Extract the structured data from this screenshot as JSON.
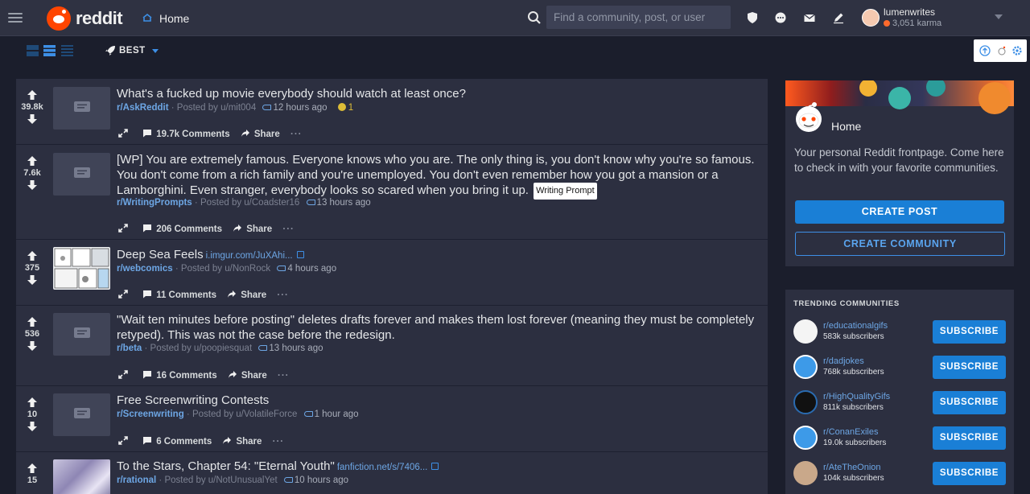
{
  "app": {
    "wordmark": "reddit"
  },
  "header": {
    "home_label": "Home",
    "search_placeholder": "Find a community, post, or user",
    "icons": [
      "menu-icon",
      "reddit-logo-icon",
      "home-icon",
      "search-icon",
      "shield-icon",
      "chat-icon",
      "mail-icon",
      "pencil-icon"
    ],
    "user": {
      "name": "lumenwrites",
      "karma": "3,051 karma"
    }
  },
  "subbar": {
    "sort_label": "BEST",
    "view_modes": [
      "card-view",
      "classic-view",
      "compact-view"
    ],
    "tools": [
      "arrow-up-circle-icon",
      "snoo-icon",
      "gear-icon"
    ]
  },
  "posts": [
    {
      "score": "39.8k",
      "title": "What's a fucked up movie everybody should watch at least once?",
      "flair": "",
      "domain": "",
      "sub": "r/AskReddit",
      "posted_by": "· Posted by u/mit004",
      "time": "12 hours ago",
      "awards": "1",
      "comments": "19.7k Comments",
      "share": "Share"
    },
    {
      "score": "7.6k",
      "title": "[WP] You are extremely famous. Everyone knows who you are. The only thing is, you don't know why you're so famous. You don't come from a rich family and you're unemployed. You don't even remember how you got a mansion or a Lamborghini. Even stranger, everybody looks so scared when you bring it up.",
      "flair": "Writing Prompt",
      "domain": "",
      "sub": "r/WritingPrompts",
      "posted_by": "· Posted by u/Coadster16",
      "time": "13 hours ago",
      "awards": "",
      "comments": "206 Comments",
      "share": "Share"
    },
    {
      "score": "375",
      "title": "Deep Sea Feels",
      "flair": "",
      "domain": "i.imgur.com/JuXAhi...",
      "sub": "r/webcomics",
      "posted_by": "· Posted by u/NonRock",
      "time": "4 hours ago",
      "awards": "",
      "comments": "11 Comments",
      "share": "Share"
    },
    {
      "score": "536",
      "title": "\"Wait ten minutes before posting\" deletes drafts forever and makes them lost forever (meaning they must be completely retyped). This was not the case before the redesign.",
      "flair": "",
      "domain": "",
      "sub": "r/beta",
      "posted_by": "· Posted by u/poopiesquat",
      "time": "13 hours ago",
      "awards": "",
      "comments": "16 Comments",
      "share": "Share"
    },
    {
      "score": "10",
      "title": "Free Screenwriting Contests",
      "flair": "",
      "domain": "",
      "sub": "r/Screenwriting",
      "posted_by": "· Posted by u/VolatileForce",
      "time": "1 hour ago",
      "awards": "",
      "comments": "6 Comments",
      "share": "Share"
    },
    {
      "score": "15",
      "title": "To the Stars, Chapter 54: \"Eternal Youth\"",
      "flair": "",
      "domain": "fanfiction.net/s/7406...",
      "sub": "r/rational",
      "posted_by": "· Posted by u/NotUnusualYet",
      "time": "10 hours ago",
      "awards": "",
      "comments": "",
      "share": ""
    }
  ],
  "sidebar": {
    "home_card": {
      "title": "Home",
      "description": "Your personal Reddit frontpage. Come here to check in with your favorite communities.",
      "create_post": "CREATE POST",
      "create_community": "CREATE COMMUNITY"
    },
    "trending": {
      "heading": "TRENDING COMMUNITIES",
      "subscribe_label": "SUBSCRIBE",
      "communities": [
        {
          "name": "r/educationalgifs",
          "subscribers": "583k subscribers"
        },
        {
          "name": "r/dadjokes",
          "subscribers": "768k subscribers"
        },
        {
          "name": "r/HighQualityGifs",
          "subscribers": "811k subscribers"
        },
        {
          "name": "r/ConanExiles",
          "subscribers": "19.0k subscribers"
        },
        {
          "name": "r/AteTheOnion",
          "subscribers": "104k subscribers"
        }
      ]
    }
  },
  "colors": {
    "accent": "#1a7fd6",
    "background": "#1b1e2c",
    "card": "#2c2f40",
    "header": "#2f3242",
    "brand": "#ff4500"
  }
}
